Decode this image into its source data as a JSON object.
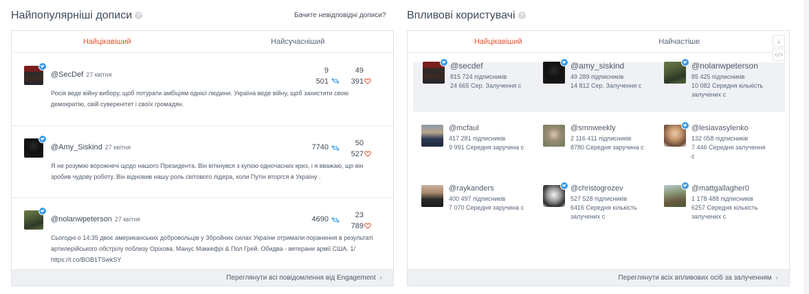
{
  "left": {
    "title": "Найпопулярніші дописи",
    "unread_link": "Бачите невідповідні дописи?",
    "tabs": [
      {
        "label": "Найцікавіший",
        "active": true
      },
      {
        "label": "Найсучасніший",
        "active": false
      }
    ],
    "posts": [
      {
        "handle": "@SecDef",
        "date": "27 квітня",
        "retweets": "9 501",
        "likes": "49 391",
        "text": "Росія веде війну вибору, щоб потурати амбіціям однієї людини. Україна веде війну, щоб захистити свою демократію, свій суверенітет і своїх громадян."
      },
      {
        "handle": "@Amy_Siskind",
        "date": "27 квітня",
        "retweets": "7740",
        "likes": "50 527",
        "text": "Я не розумію ворожнечі щодо нашого Президента. Він віткнувся з купою одночасних криз, і я вважаю, що він зробив чудову роботу. Він відновив нашу роль світового лідера, коли Путін вторгся в Україну ."
      },
      {
        "handle": "@nolanwpeterson",
        "date": "27 квітня",
        "retweets": "4690",
        "likes": "23 789",
        "text": "Сьогодні о 14:35 двоє американських добровольців у Збройних силах України отримали поранення в результаті артилерійського обстрілу поблизу Оріхова. Манус Маккефрі & Пол Грей. Обидва - ветерани армії США. 1/ https://t.co/BOB1TSwkSY"
      }
    ],
    "footer": "Переглянути всі повідомлення від Engagement"
  },
  "right": {
    "title": "Впливові користувачі",
    "tabs": [
      {
        "label": "Найцікавіший",
        "active": true
      },
      {
        "label": "Найчастіше",
        "active": false
      }
    ],
    "tools": [
      "download-icon",
      "code-icon"
    ],
    "influencers": [
      {
        "handle": "@secdef",
        "line1": "815 724 підписників",
        "line2": "24 665 Сер. Залучення с",
        "line3": ""
      },
      {
        "handle": "@amy_siskind",
        "line1": "49 289 підписників",
        "line2": "14 812 Сер. Залучення с",
        "line3": ""
      },
      {
        "handle": "@nolanwpeterson",
        "line1": "85 425 підписників",
        "line2": "10 082 Середня кількість",
        "line3": "залучених с"
      },
      {
        "handle": "@mcfaul",
        "line1": "417 281 підписників",
        "line2": "9 991 Середня заручина с",
        "line3": ""
      },
      {
        "handle": "@smnweekly",
        "line1": "2 116 411 підписників",
        "line2": "8780 Середня заручина с",
        "line3": ""
      },
      {
        "handle": "@lesiavasylenko",
        "line1": "132 058 підписників",
        "line2": "7 446 Середня залучення",
        "line3": "с"
      },
      {
        "handle": "@raykanders",
        "line1": "400 497 підписників",
        "line2": "7 070 Середня заручина с",
        "line3": ""
      },
      {
        "handle": "@christogrozev",
        "line1": "527 528 підписників",
        "line2": "6416 Середня кількість",
        "line3": "залучених с"
      },
      {
        "handle": "@mattgallagher0",
        "line1": "1 178 488 підписників",
        "line2": "6257 Середня кількість",
        "line3": "залучених с"
      }
    ],
    "footer": "Переглянути всіх впливових осіб за залученням"
  },
  "colors": {
    "accent": "#e5532e",
    "twitter": "#3d9ce6",
    "retweet": "#3d9ce6",
    "heart": "#e5532e"
  }
}
